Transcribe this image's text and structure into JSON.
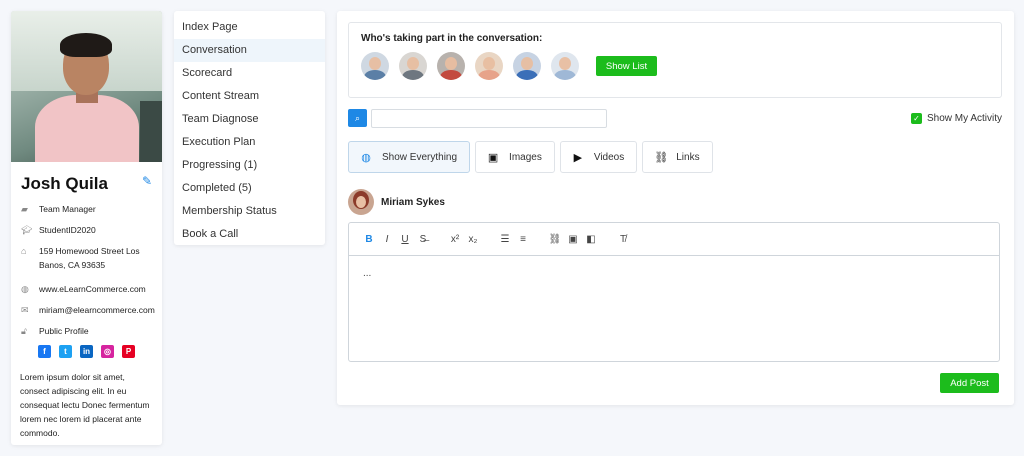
{
  "profile": {
    "name": "Josh Quila",
    "role": "Team Manager",
    "student_id": "StudentID2020",
    "address": "159 Homewood Street Los Banos, CA 93635",
    "website": "www.eLearnCommerce.com",
    "email": "miriam@elearncommerce.com",
    "visibility": "Public Profile",
    "socials": [
      "facebook-icon",
      "twitter-icon",
      "linkedin-icon",
      "instagram-icon",
      "pinterest-icon"
    ],
    "bio": "Lorem ipsum dolor sit amet, consect adipiscing elit. In eu consequat lectu Donec fermentum lorem nec lorem id placerat ante commodo."
  },
  "menu": {
    "items": [
      {
        "label": "Index Page"
      },
      {
        "label": "Conversation",
        "active": true
      },
      {
        "label": "Scorecard"
      },
      {
        "label": "Content Stream"
      },
      {
        "label": "Team Diagnose"
      },
      {
        "label": "Execution Plan"
      },
      {
        "label": "Progressing (1)"
      },
      {
        "label": "Completed (5)"
      },
      {
        "label": "Membership Status"
      },
      {
        "label": "Book a Call"
      }
    ]
  },
  "participants": {
    "title": "Who's taking part in the conversation:",
    "show_list_label": "Show List",
    "avatar_colors": [
      "#5b7fa6",
      "#6e7780",
      "#c34a3f",
      "#e7a38a",
      "#3b6fb8",
      "#9fb8d6"
    ]
  },
  "search": {
    "placeholder": ""
  },
  "activity": {
    "label": "Show My Activity",
    "checked": true
  },
  "filters": [
    {
      "label": "Show Everything",
      "icon": "globe-icon",
      "active": true
    },
    {
      "label": "Images",
      "icon": "image-file-icon"
    },
    {
      "label": "Videos",
      "icon": "video-file-icon"
    },
    {
      "label": "Links",
      "icon": "link-icon"
    }
  ],
  "composer": {
    "author": "Miriam Sykes",
    "content": "...",
    "submit_label": "Add Post"
  },
  "colors": {
    "accent_blue": "#1e88e5",
    "accent_green": "#1cbc1c"
  }
}
